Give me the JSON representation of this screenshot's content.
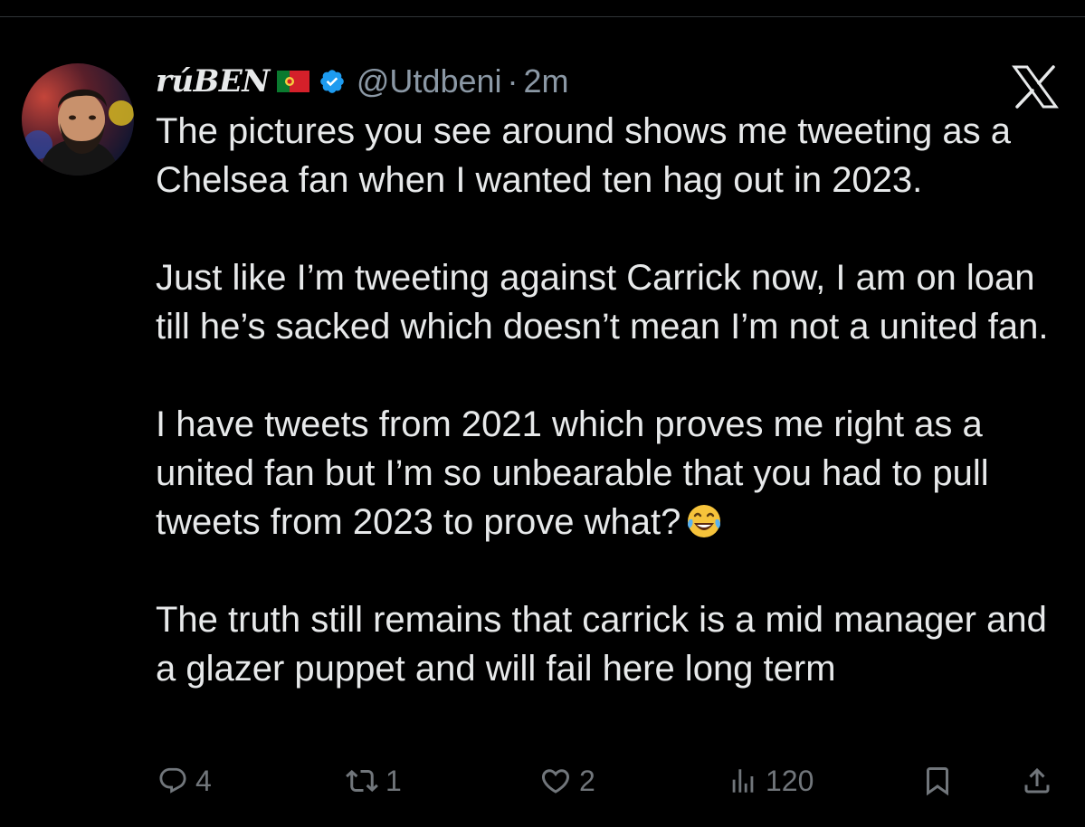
{
  "tweet": {
    "author": {
      "display_name": "rúBEN",
      "flag": "portugal-flag",
      "verified": true,
      "handle": "@Utdbeni",
      "separator": "·",
      "time": "2m"
    },
    "paragraphs": [
      "The pictures you see around shows me tweeting as a Chelsea fan when I wanted ten hag out in 2023.",
      "Just like I’m tweeting against Carrick now, I am on loan till he’s sacked which doesn’t mean I’m not a united fan.",
      "I have tweets from 2021 which proves me right as a united fan but I’m so unbearable that you had to pull tweets from 2023 to prove what?",
      "The truth still remains that carrick is a mid manager and a glazer puppet and will fail here long term"
    ],
    "emoji": "face-with-tears-of-joy-emoji",
    "actions": {
      "replies": "4",
      "reposts": "1",
      "likes": "2",
      "views": "120"
    }
  },
  "colors": {
    "background": "#000000",
    "text": "#e7e9ea",
    "muted": "#71767b",
    "handle": "#8b98a5",
    "verified": "#1d9bf0"
  },
  "icons": [
    "x-logo-icon",
    "reply-icon",
    "repost-icon",
    "like-icon",
    "views-icon",
    "bookmark-icon",
    "share-icon"
  ]
}
